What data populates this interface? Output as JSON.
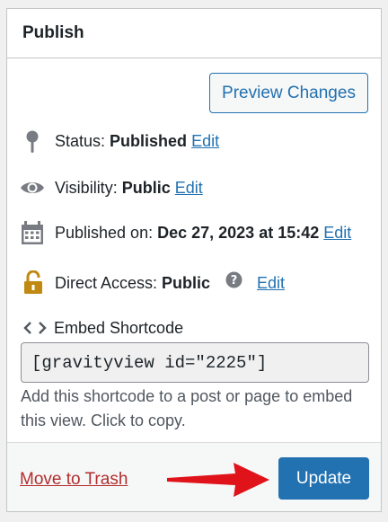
{
  "panel": {
    "title": "Publish",
    "preview_label": "Preview Changes",
    "status": {
      "label": "Status:",
      "value": "Published",
      "edit": "Edit",
      "icon": "pin-icon"
    },
    "visibility": {
      "label": "Visibility:",
      "value": "Public",
      "edit": "Edit",
      "icon": "eye-icon"
    },
    "published_on": {
      "label": "Published on:",
      "value": "Dec 27, 2023 at 15:42",
      "edit": "Edit",
      "icon": "calendar-icon"
    },
    "direct_access": {
      "label": "Direct Access:",
      "value": "Public",
      "edit": "Edit",
      "icon": "lock-icon"
    },
    "embed": {
      "label": "Embed Shortcode",
      "shortcode": "[gravityview id=\"2225\"]",
      "help": "Add this shortcode to a post or page to embed this view. Click to copy."
    },
    "footer": {
      "trash_label": "Move to Trash",
      "update_label": "Update"
    }
  },
  "colors": {
    "accent": "#2271b1",
    "danger": "#b32d2e",
    "arrow": "#e0131a",
    "lock": "#c08a12"
  }
}
